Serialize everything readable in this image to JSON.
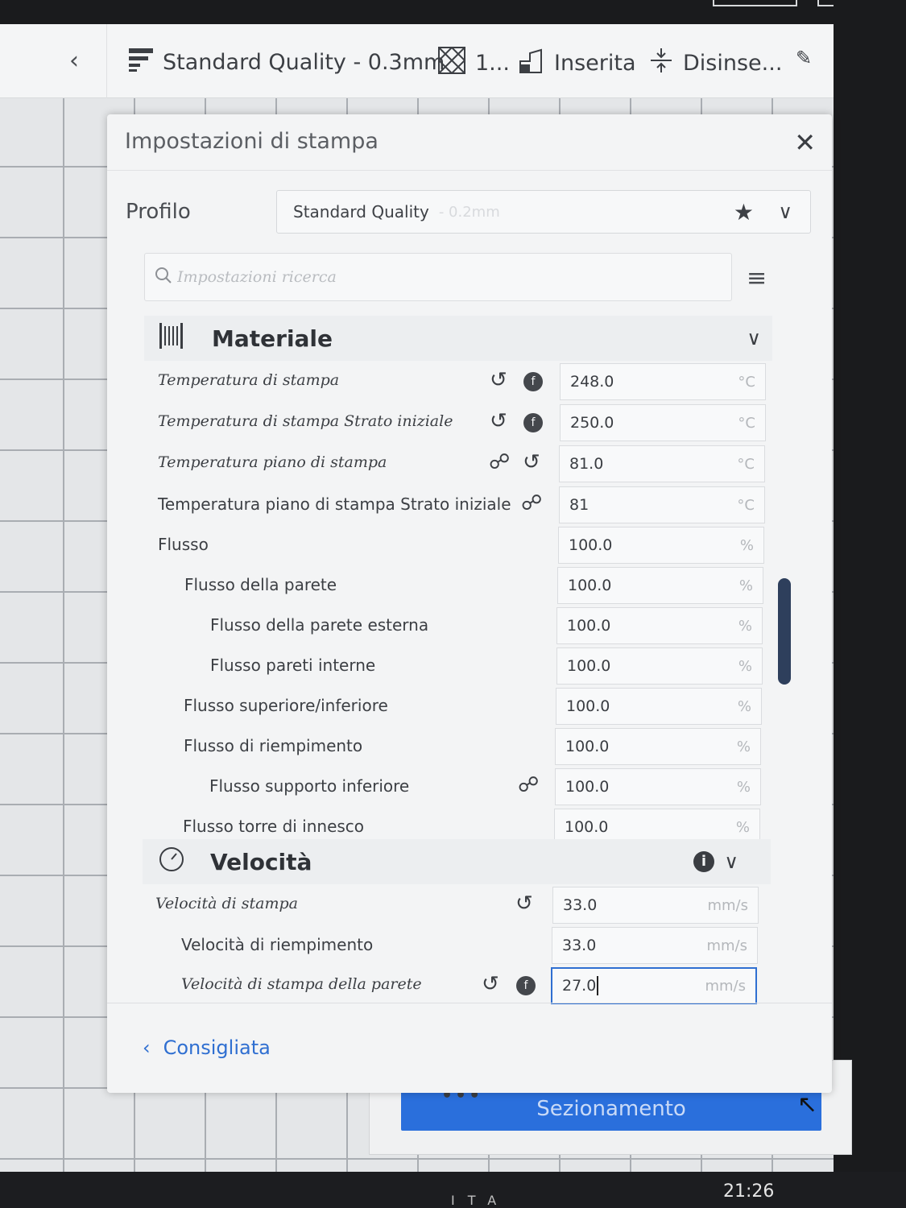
{
  "header": {
    "profile_name": "Standard Quality - 0.3mm",
    "extruders_label": "1...",
    "support_label": "Inserita",
    "adhesion_label": "Disinse...",
    "back_icon": "chevron-left-icon",
    "edit_icon": "pencil-icon"
  },
  "panel": {
    "title": "Impostazioni di stampa",
    "profile_label": "Profilo",
    "profile_value": "Standard Quality",
    "profile_value_faint": "- 0.2mm",
    "search_placeholder": "Impostazioni ricerca",
    "footer_button": "Consigliata"
  },
  "sections": [
    {
      "title": "Materiale",
      "icon": "material-barcode-icon",
      "rows": [
        {
          "label": "Temperatura di stampa",
          "value": "248.0",
          "unit": "°C"
        },
        {
          "label": "Temperatura di stampa Strato iniziale",
          "value": "250.0",
          "unit": "°C"
        },
        {
          "label": "Temperatura piano di stampa",
          "value": "81.0",
          "unit": "°C"
        },
        {
          "label": "Temperatura piano di stampa Strato iniziale",
          "value": "81",
          "unit": "°C"
        },
        {
          "label": "Flusso",
          "value": "100.0",
          "unit": "%"
        },
        {
          "label": "Flusso della parete",
          "value": "100.0",
          "unit": "%"
        },
        {
          "label": "Flusso della parete esterna",
          "value": "100.0",
          "unit": "%"
        },
        {
          "label": "Flusso pareti interne",
          "value": "100.0",
          "unit": "%"
        },
        {
          "label": "Flusso superiore/inferiore",
          "value": "100.0",
          "unit": "%"
        },
        {
          "label": "Flusso di riempimento",
          "value": "100.0",
          "unit": "%"
        },
        {
          "label": "Flusso supporto inferiore",
          "value": "100.0",
          "unit": "%"
        },
        {
          "label": "Flusso torre di innesco",
          "value": "100.0",
          "unit": "%"
        }
      ]
    },
    {
      "title": "Velocità",
      "icon": "speedometer-icon",
      "rows": [
        {
          "label": "Velocità di stampa",
          "value": "33.0",
          "unit": "mm/s"
        },
        {
          "label": "Velocità di riempimento",
          "value": "33.0",
          "unit": "mm/s"
        },
        {
          "label": "Velocità di stampa della parete",
          "value": "27.0",
          "unit": "mm/s"
        }
      ]
    }
  ],
  "slice_button": "Sezionamento",
  "taskbar": {
    "clock": "21:26",
    "tray": "ITA"
  },
  "colors": {
    "accent": "#2a6fdc",
    "scrollbar": "#2e3f5c",
    "panel_bg": "#f3f4f5"
  }
}
